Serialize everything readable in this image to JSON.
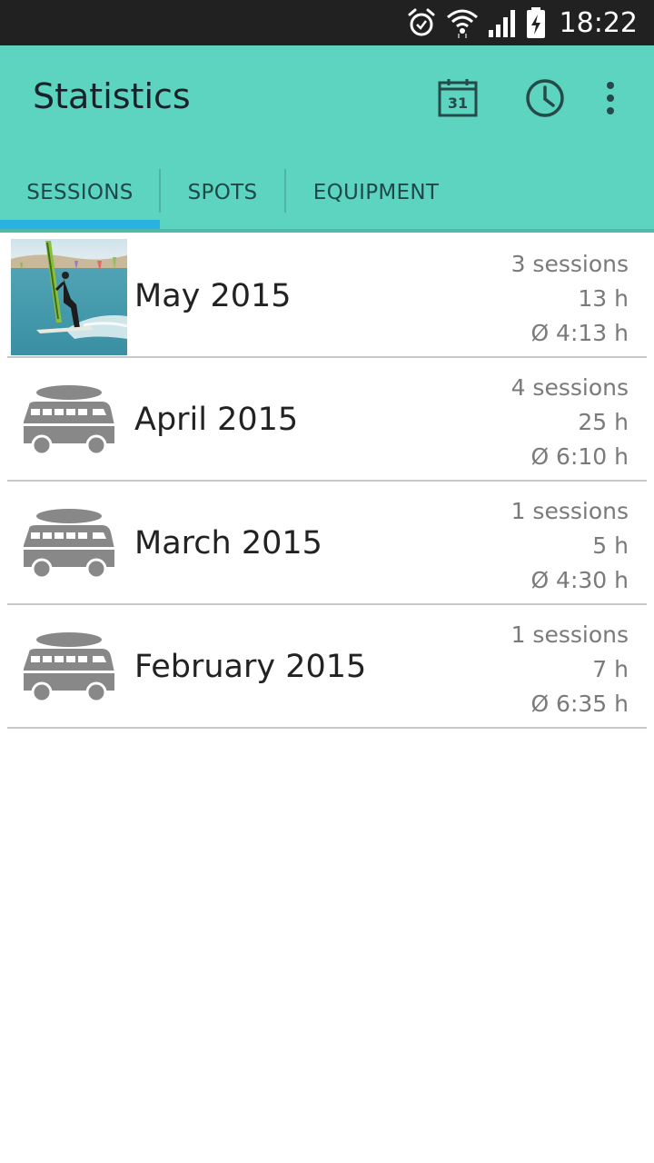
{
  "status_bar": {
    "time": "18:22",
    "icons": [
      "alarm-icon",
      "wifi-icon",
      "signal-icon",
      "battery-charging-icon"
    ]
  },
  "app_bar": {
    "title": "Statistics",
    "calendar_day": "31",
    "actions": [
      "calendar-icon",
      "history-clock-icon",
      "overflow-menu-icon"
    ]
  },
  "tabs": [
    {
      "label": "SESSIONS",
      "selected": true
    },
    {
      "label": "SPOTS",
      "selected": false
    },
    {
      "label": "EQUIPMENT",
      "selected": false
    }
  ],
  "months": [
    {
      "label": "May 2015",
      "sessions": "3 sessions",
      "total": "13 h",
      "average": "Ø 4:13 h",
      "thumbnail": "windsurfer-photo"
    },
    {
      "label": "April 2015",
      "sessions": "4 sessions",
      "total": "25 h",
      "average": "Ø 6:10 h",
      "thumbnail": "van-icon"
    },
    {
      "label": "March 2015",
      "sessions": "1 sessions",
      "total": "5 h",
      "average": "Ø 4:30 h",
      "thumbnail": "van-icon"
    },
    {
      "label": "February 2015",
      "sessions": "1 sessions",
      "total": "7 h",
      "average": "Ø 6:35 h",
      "thumbnail": "van-icon"
    }
  ],
  "colors": {
    "app_bar": "#5dd4bf",
    "tab_indicator": "#29b2e0",
    "status_bar": "#212121",
    "icon_dark": "#264a4a",
    "van_gray": "#888888"
  }
}
